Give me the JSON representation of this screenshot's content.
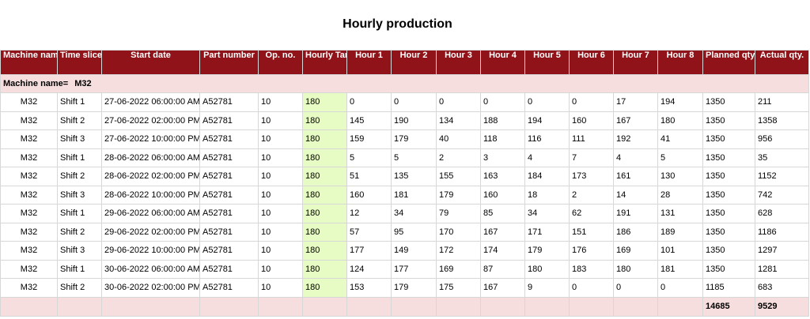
{
  "report": {
    "title": "Hourly production"
  },
  "table": {
    "headers": {
      "machine_name": "Machine name",
      "time_slice": "Time slice",
      "start_date": "Start date",
      "part_number": "Part number",
      "op_no": "Op. no.",
      "hourly_target": "Hourly Target",
      "hour1": "Hour 1",
      "hour2": "Hour 2",
      "hour3": "Hour 3",
      "hour4": "Hour 4",
      "hour5": "Hour 5",
      "hour6": "Hour 6",
      "hour7": "Hour 7",
      "hour8": "Hour 8",
      "planned_qty": "Planned qty",
      "actual_qty": "Actual qty."
    },
    "group": {
      "label": "Machine name=",
      "value": "M32"
    },
    "rows": [
      {
        "machine": "M32",
        "slice": "Shift 1",
        "start": "27-06-2022 06:00:00 AM",
        "part": "A52781",
        "op": "10",
        "target": "180",
        "h1": "0",
        "h2": "0",
        "h3": "0",
        "h4": "0",
        "h5": "0",
        "h6": "0",
        "h7": "17",
        "h8": "194",
        "planned": "1350",
        "actual": "211"
      },
      {
        "machine": "M32",
        "slice": "Shift 2",
        "start": "27-06-2022 02:00:00 PM",
        "part": "A52781",
        "op": "10",
        "target": "180",
        "h1": "145",
        "h2": "190",
        "h3": "134",
        "h4": "188",
        "h5": "194",
        "h6": "160",
        "h7": "167",
        "h8": "180",
        "planned": "1350",
        "actual": "1358"
      },
      {
        "machine": "M32",
        "slice": "Shift 3",
        "start": "27-06-2022 10:00:00 PM",
        "part": "A52781",
        "op": "10",
        "target": "180",
        "h1": "159",
        "h2": "179",
        "h3": "40",
        "h4": "118",
        "h5": "116",
        "h6": "111",
        "h7": "192",
        "h8": "41",
        "planned": "1350",
        "actual": "956"
      },
      {
        "machine": "M32",
        "slice": "Shift 1",
        "start": "28-06-2022 06:00:00 AM",
        "part": "A52781",
        "op": "10",
        "target": "180",
        "h1": "5",
        "h2": "5",
        "h3": "2",
        "h4": "3",
        "h5": "4",
        "h6": "7",
        "h7": "4",
        "h8": "5",
        "planned": "1350",
        "actual": "35"
      },
      {
        "machine": "M32",
        "slice": "Shift 2",
        "start": "28-06-2022 02:00:00 PM",
        "part": "A52781",
        "op": "10",
        "target": "180",
        "h1": "51",
        "h2": "135",
        "h3": "155",
        "h4": "163",
        "h5": "184",
        "h6": "173",
        "h7": "161",
        "h8": "130",
        "planned": "1350",
        "actual": "1152"
      },
      {
        "machine": "M32",
        "slice": "Shift 3",
        "start": "28-06-2022 10:00:00 PM",
        "part": "A52781",
        "op": "10",
        "target": "180",
        "h1": "160",
        "h2": "181",
        "h3": "179",
        "h4": "160",
        "h5": "18",
        "h6": "2",
        "h7": "14",
        "h8": "28",
        "planned": "1350",
        "actual": "742"
      },
      {
        "machine": "M32",
        "slice": "Shift 1",
        "start": "29-06-2022 06:00:00 AM",
        "part": "A52781",
        "op": "10",
        "target": "180",
        "h1": "12",
        "h2": "34",
        "h3": "79",
        "h4": "85",
        "h5": "34",
        "h6": "62",
        "h7": "191",
        "h8": "131",
        "planned": "1350",
        "actual": "628"
      },
      {
        "machine": "M32",
        "slice": "Shift 2",
        "start": "29-06-2022 02:00:00 PM",
        "part": "A52781",
        "op": "10",
        "target": "180",
        "h1": "57",
        "h2": "95",
        "h3": "170",
        "h4": "167",
        "h5": "171",
        "h6": "151",
        "h7": "186",
        "h8": "189",
        "planned": "1350",
        "actual": "1186"
      },
      {
        "machine": "M32",
        "slice": "Shift 3",
        "start": "29-06-2022 10:00:00 PM",
        "part": "A52781",
        "op": "10",
        "target": "180",
        "h1": "177",
        "h2": "149",
        "h3": "172",
        "h4": "174",
        "h5": "179",
        "h6": "176",
        "h7": "169",
        "h8": "101",
        "planned": "1350",
        "actual": "1297"
      },
      {
        "machine": "M32",
        "slice": "Shift 1",
        "start": "30-06-2022 06:00:00 AM",
        "part": "A52781",
        "op": "10",
        "target": "180",
        "h1": "124",
        "h2": "177",
        "h3": "169",
        "h4": "87",
        "h5": "180",
        "h6": "183",
        "h7": "180",
        "h8": "181",
        "planned": "1350",
        "actual": "1281"
      },
      {
        "machine": "M32",
        "slice": "Shift 2",
        "start": "30-06-2022 02:00:00 PM",
        "part": "A52781",
        "op": "10",
        "target": "180",
        "h1": "153",
        "h2": "179",
        "h3": "175",
        "h4": "167",
        "h5": "9",
        "h6": "0",
        "h7": "0",
        "h8": "0",
        "planned": "1185",
        "actual": "683"
      }
    ],
    "totals": {
      "planned": "14685",
      "actual": "9529"
    }
  },
  "colors": {
    "header_bg": "#8f1318",
    "group_bg": "#f6dede",
    "target_bg": "#e7fbc4"
  }
}
